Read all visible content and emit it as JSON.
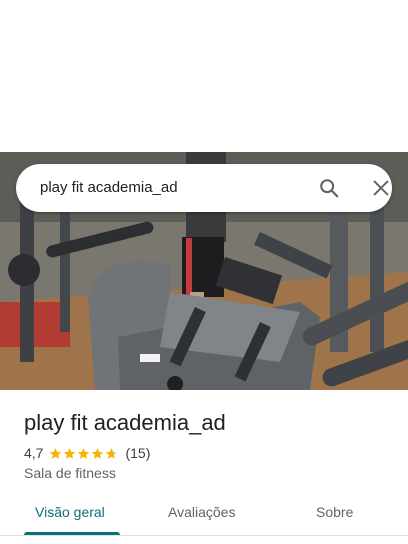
{
  "search": {
    "query": "play fit academia_ad",
    "search_icon": "search-icon",
    "close_icon": "close-icon"
  },
  "photo": {
    "description_icon": "gym-photo"
  },
  "place": {
    "title": "play fit academia_ad",
    "rating": "4,7",
    "rating_stars": 4.7,
    "review_count": "(15)",
    "category": "Sala de fitness"
  },
  "tabs": [
    {
      "label": "Visão geral",
      "active": true
    },
    {
      "label": "Avaliações",
      "active": false
    },
    {
      "label": "Sobre",
      "active": false
    }
  ],
  "colors": {
    "accent": "#0f6e78",
    "star": "#f4b400"
  }
}
